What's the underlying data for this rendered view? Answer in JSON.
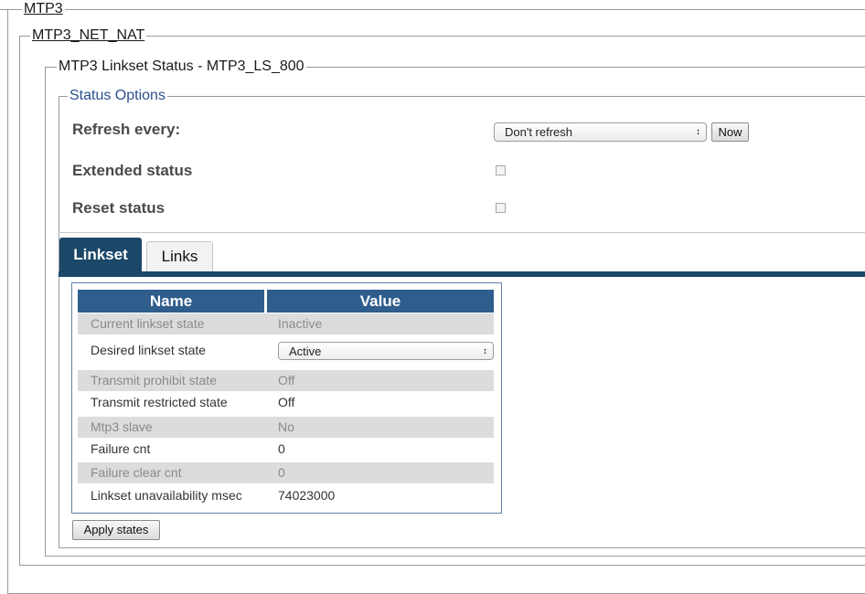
{
  "frames": {
    "root": "MTP3",
    "net": "MTP3_NET_NAT",
    "linkset_status": "MTP3 Linkset Status - MTP3_LS_800",
    "status_options": "Status Options"
  },
  "status_options": {
    "refresh_label": "Refresh every:",
    "refresh_selected": "Don't refresh",
    "now_button": "Now",
    "extended_label": "Extended status",
    "extended_checked": false,
    "reset_label": "Reset status",
    "reset_checked": false
  },
  "tabs": [
    {
      "label": "Linkset",
      "active": true
    },
    {
      "label": "Links",
      "active": false
    }
  ],
  "table": {
    "headers": {
      "name": "Name",
      "value": "Value"
    },
    "rows": [
      {
        "name": "Current linkset state",
        "value": "Inactive"
      },
      {
        "name": "Desired linkset state",
        "value": "Active"
      },
      {
        "name": "Transmit prohibit state",
        "value": "Off"
      },
      {
        "name": "Transmit restricted state",
        "value": "Off"
      },
      {
        "name": "Mtp3 slave",
        "value": "No"
      },
      {
        "name": "Failure cnt",
        "value": "0"
      },
      {
        "name": "Failure clear cnt",
        "value": "0"
      },
      {
        "name": "Linkset unavailability msec",
        "value": "74023000"
      }
    ]
  },
  "apply_button": "Apply states",
  "colors": {
    "tab_active_bg": "#1b4769",
    "table_header_bg": "#2f5d8c",
    "legend_accent": "#2b4f8f",
    "row_shade": "#dcdcdc"
  }
}
